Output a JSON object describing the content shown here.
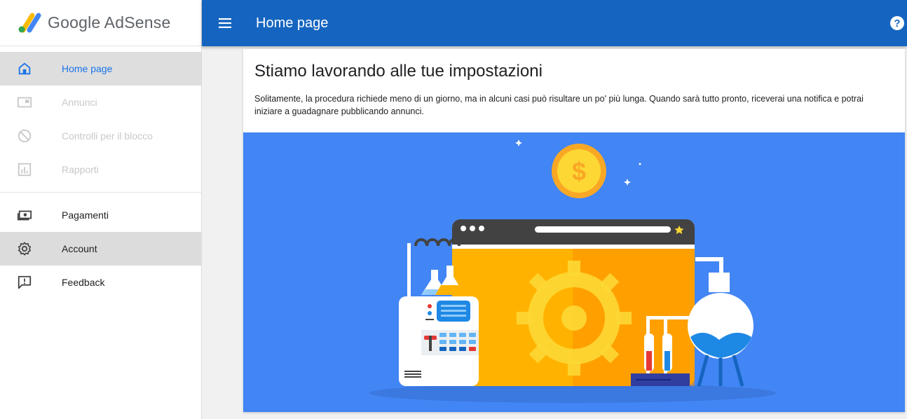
{
  "brand": {
    "name": "Google AdSense"
  },
  "header": {
    "title": "Home page",
    "menu_icon": "hamburger-menu-icon",
    "help_icon": "help-icon",
    "help_glyph": "?"
  },
  "sidebar": {
    "items": [
      {
        "label": "Home page",
        "icon": "home-icon",
        "state": "active"
      },
      {
        "label": "Annunci",
        "icon": "ads-icon",
        "state": "disabled"
      },
      {
        "label": "Controlli per il blocco",
        "icon": "block-icon",
        "state": "disabled"
      },
      {
        "label": "Rapporti",
        "icon": "reports-icon",
        "state": "disabled"
      },
      {
        "label": "Pagamenti",
        "icon": "payments-icon",
        "state": "normal"
      },
      {
        "label": "Account",
        "icon": "gear-icon",
        "state": "hover"
      },
      {
        "label": "Feedback",
        "icon": "feedback-icon",
        "state": "normal"
      }
    ]
  },
  "main": {
    "title": "Stiamo lavorando alle tue impostazioni",
    "body": "Solitamente, la procedura richiede meno di un giorno, ma in alcuni casi può risultare un po' più lunga. Quando sarà tutto pronto, riceverai una notifica e potrai iniziare a guadagnare pubblicando annunci."
  },
  "colors": {
    "header_bg": "#1565c0",
    "illustration_bg": "#4285f4",
    "accent": "#1a73e8",
    "coin": "#fbc02d"
  }
}
